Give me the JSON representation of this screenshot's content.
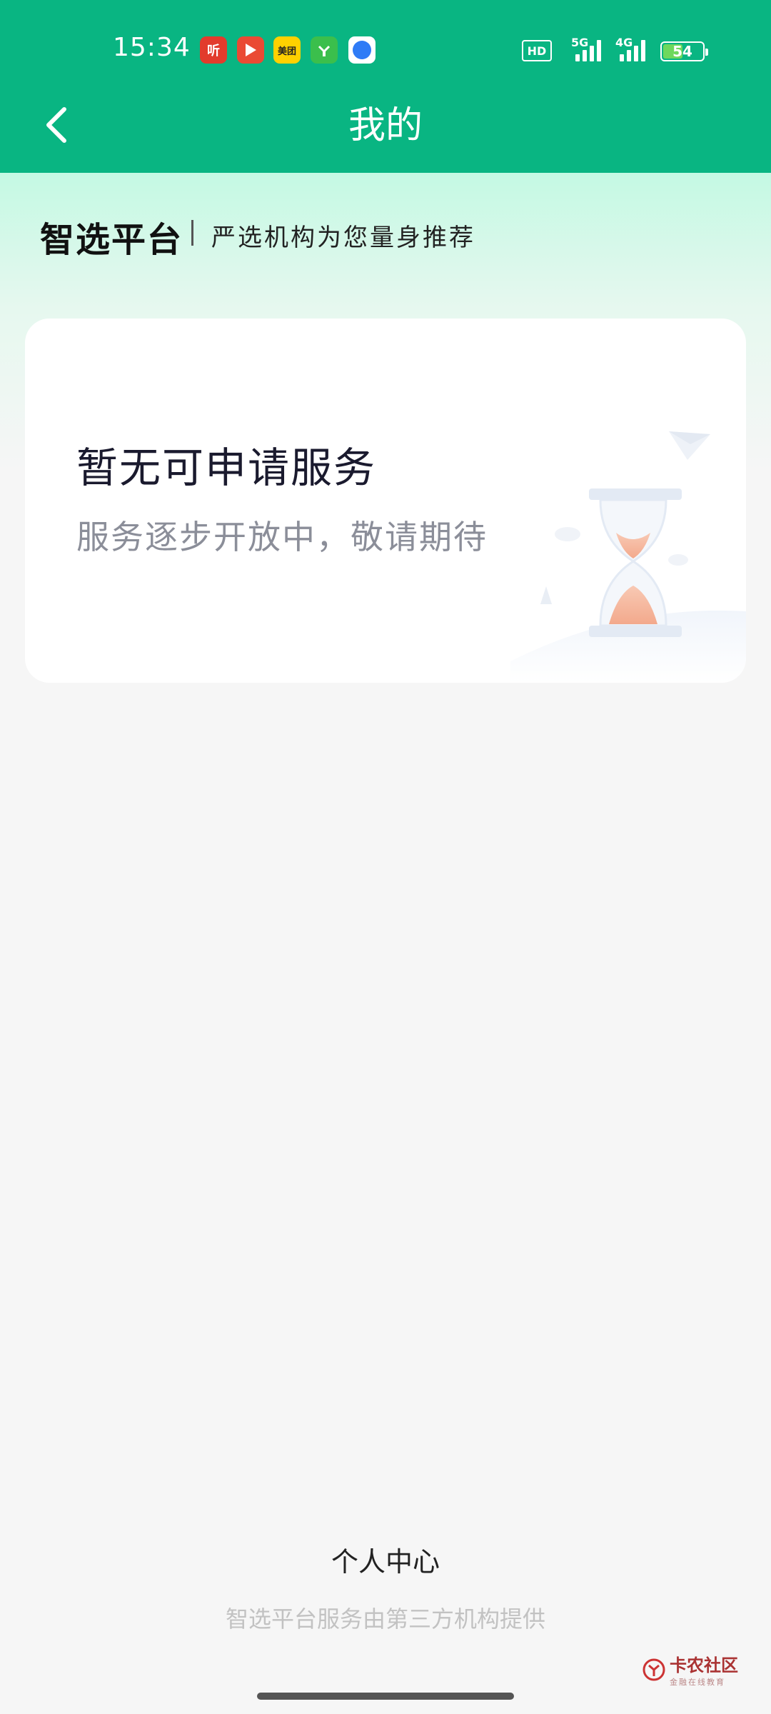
{
  "status_bar": {
    "time": "15:34",
    "app_icons": [
      "ting-app-icon",
      "video-app-icon",
      "meituan-app-icon",
      "shopping-app-icon",
      "browser-app-icon"
    ],
    "meituan_label": "美团",
    "ting_label": "听",
    "hd_label": "HD",
    "signal1_label": "5G",
    "signal2_label": "4G",
    "battery_level": "54"
  },
  "header": {
    "title": "我的",
    "background_color": "#09b582"
  },
  "brand": {
    "name": "智选平台",
    "slogan": "严选机构为您量身推荐"
  },
  "empty_card": {
    "title": "暂无可申请服务",
    "subtitle": "服务逐步开放中，敬请期待",
    "illustration": "hourglass-illustration"
  },
  "footer": {
    "link": "个人中心",
    "note": "智选平台服务由第三方机构提供"
  },
  "watermark": {
    "main": "卡农社区",
    "sub": "金融在线教育"
  }
}
